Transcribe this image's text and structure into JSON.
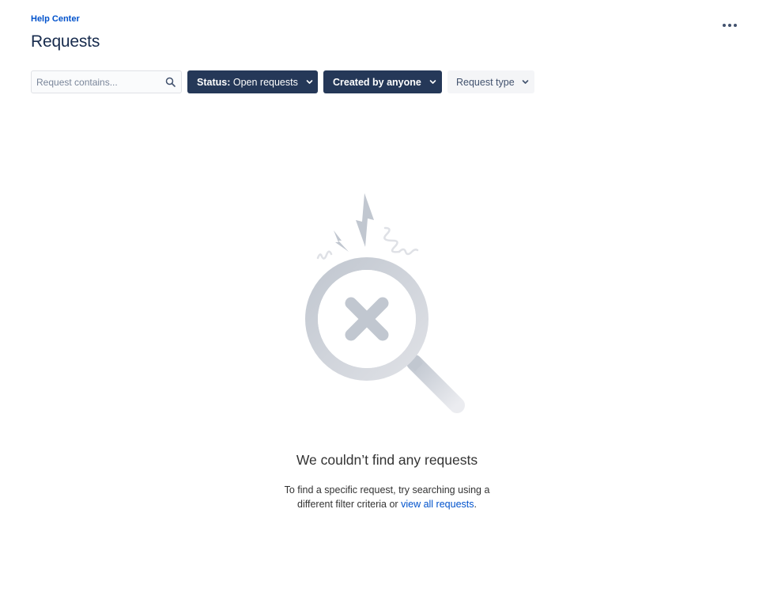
{
  "header": {
    "breadcrumb": "Help Center",
    "title": "Requests",
    "more_icon": "more-horizontal-icon"
  },
  "filters": {
    "search": {
      "placeholder": "Request contains...",
      "value": "",
      "icon": "search-icon"
    },
    "status": {
      "label": "Status:",
      "value": "Open requests",
      "icon": "chevron-down-icon"
    },
    "created_by": {
      "label": "Created by anyone",
      "icon": "chevron-down-icon"
    },
    "request_type": {
      "label": "Request type",
      "icon": "chevron-down-icon"
    }
  },
  "empty_state": {
    "illustration": "magnifier-no-results-icon",
    "title": "We couldn’t find any requests",
    "description_line1": "To find a specific request, try searching using a",
    "description_line2": "different filter criteria or",
    "link_text": "view all requests",
    "link_suffix": "."
  },
  "colors": {
    "link": "#0052cc",
    "dark_button": "#253858",
    "light_button": "#f4f5f7",
    "text": "#172b4d",
    "illustration": "#c1c7d0"
  }
}
